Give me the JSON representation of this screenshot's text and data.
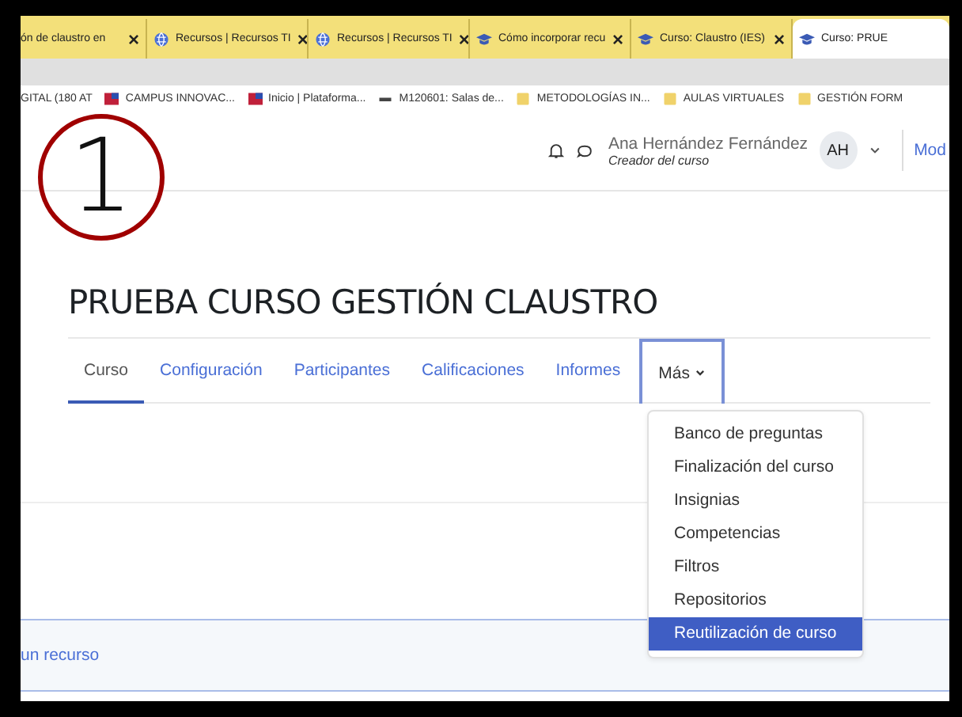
{
  "browser_tabs": [
    {
      "title": "ón de claustro en",
      "kind": "plain",
      "selected": false
    },
    {
      "title": "Recursos | Recursos TI",
      "kind": "globe",
      "selected": false
    },
    {
      "title": "Recursos | Recursos TI",
      "kind": "globe",
      "selected": false
    },
    {
      "title": "Cómo incorporar recu",
      "kind": "cap",
      "selected": false
    },
    {
      "title": "Curso: Claustro (IES)",
      "kind": "cap",
      "selected": false
    },
    {
      "title": "Curso: PRUE",
      "kind": "cap",
      "selected": true
    }
  ],
  "tab_close": "×",
  "bookmarks": [
    {
      "label": "GITAL (180 AT",
      "kind": "plain"
    },
    {
      "label": "CAMPUS INNOVAC...",
      "kind": "flag"
    },
    {
      "label": "Inicio | Plataforma...",
      "kind": "flag"
    },
    {
      "label": "M120601: Salas de...",
      "kind": "dash"
    },
    {
      "label": "METODOLOGÍAS IN...",
      "kind": "folder"
    },
    {
      "label": "AULAS VIRTUALES",
      "kind": "folder"
    },
    {
      "label": "GESTIÓN FORM",
      "kind": "folder"
    }
  ],
  "user": {
    "name": "Ana Hernández Fernández",
    "role": "Creador del curso",
    "initials": "AH"
  },
  "mode_link": "Mod",
  "course_title": "PRUEBA CURSO GESTIÓN CLAUSTRO",
  "nav_tabs": [
    {
      "label": "Curso",
      "selected": true,
      "kind": "link"
    },
    {
      "label": "Configuración",
      "selected": false,
      "kind": "link"
    },
    {
      "label": "Participantes",
      "selected": false,
      "kind": "link"
    },
    {
      "label": "Calificaciones",
      "selected": false,
      "kind": "link"
    },
    {
      "label": "Informes",
      "selected": false,
      "kind": "link"
    },
    {
      "label": "Más",
      "selected": false,
      "kind": "menu"
    }
  ],
  "more_menu": [
    {
      "label": "Banco de preguntas",
      "selected": false
    },
    {
      "label": "Finalización del curso",
      "selected": false
    },
    {
      "label": "Insignias",
      "selected": false
    },
    {
      "label": "Competencias",
      "selected": false
    },
    {
      "label": "Filtros",
      "selected": false
    },
    {
      "label": "Repositorios",
      "selected": false
    },
    {
      "label": "Reutilización de curso",
      "selected": true
    }
  ],
  "resource_link": "un recurso",
  "annotation": {
    "label": "1"
  }
}
